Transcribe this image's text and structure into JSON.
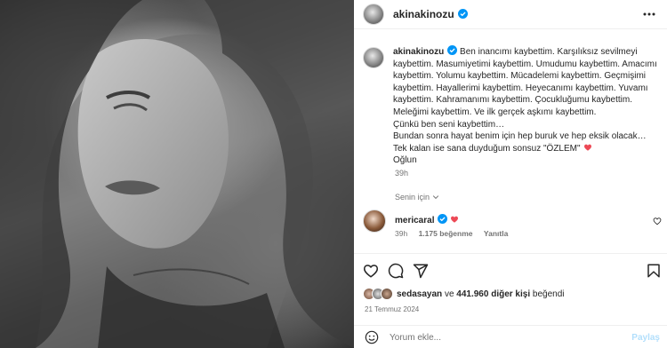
{
  "post": {
    "username": "akinakinozu",
    "caption_text": "Ben inancımı kaybettim. Karşılıksız sevilmeyi kaybettim. Masumiyetimi kaybettim. Umudumu kaybettim. Amacımı kaybettim. Yolumu kaybettim. Mücadelemi kaybettim. Geçmişimi kaybettim. Hayallerimi kaybettim. Heyecanımı kaybettim. Yuvamı kaybettim. Kahramanımı kaybettim. Çocukluğumu kaybettim. Meleğimi kaybettim. Ve ilk gerçek aşkımı kaybettim.\nÇünkü ben seni kaybettim…\nBundan sonra hayat benim için hep buruk ve hep eksik olacak…\nTek kalan ise sana duyduğum sonsuz \"ÖZLEM\"",
    "caption_sign": "Oğlun",
    "time": "39h",
    "for_you": "Senin için"
  },
  "reply": {
    "username": "mericaral",
    "time": "39h",
    "likes": "1.175 beğenme",
    "reply_label": "Yanıtla"
  },
  "likes": {
    "first_user": "sedasayan",
    "connector": "ve",
    "count": "441.960 diğer kişi",
    "suffix": "beğendi"
  },
  "date": "21 Temmuz 2024",
  "comment_box": {
    "placeholder": "Yorum ekle...",
    "post_label": "Paylaş"
  },
  "colors": {
    "verified": "#0095f6",
    "heart": "#ed4956",
    "post_disabled": "#b2dffc"
  },
  "icons": [
    "more-icon",
    "verified-icon",
    "heart-icon",
    "comment-icon",
    "share-icon",
    "bookmark-icon",
    "emoji-icon",
    "chevron-down-icon"
  ]
}
